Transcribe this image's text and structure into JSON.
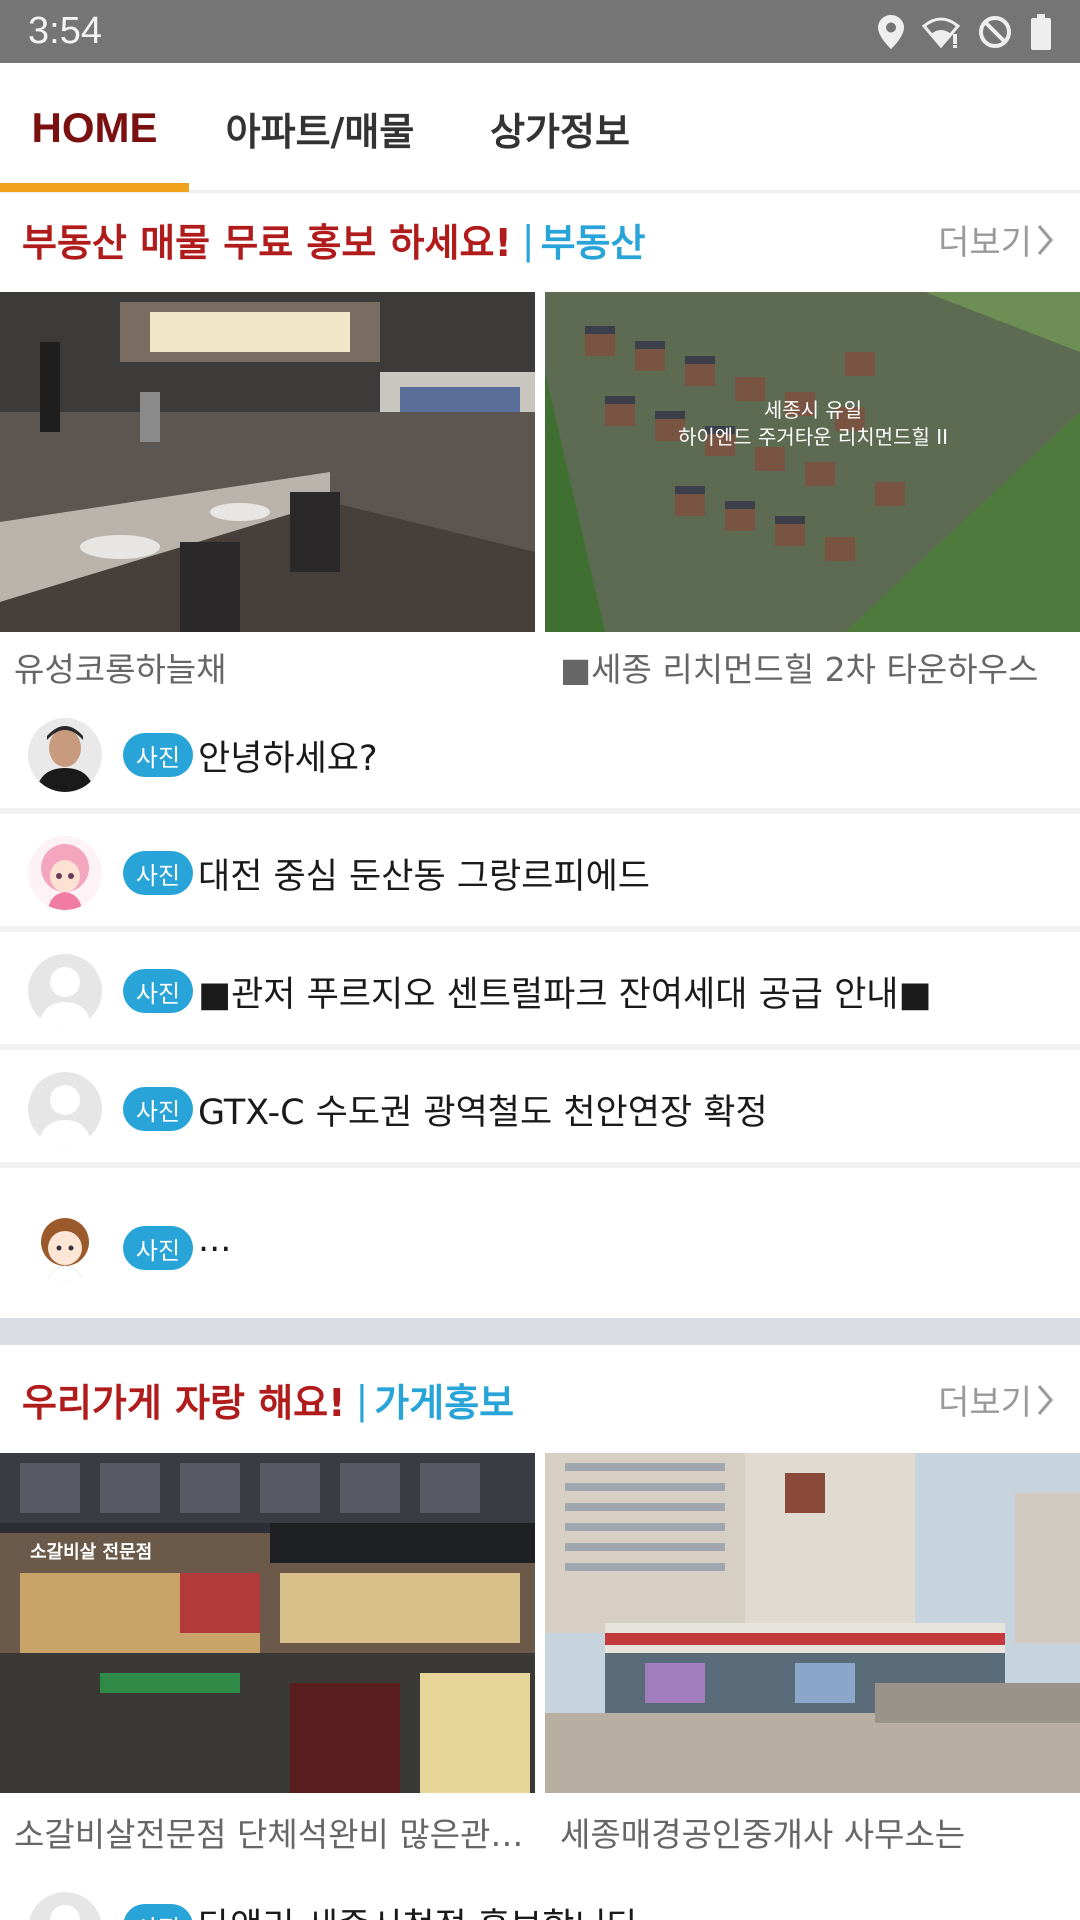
{
  "status_bar": {
    "time": "3:54"
  },
  "tabs": [
    {
      "label": "HOME"
    },
    {
      "label": "아파트/매물"
    },
    {
      "label": "상가정보"
    }
  ],
  "section1": {
    "title": "부동산 매물 무료 홍보 하세요!",
    "separator": "|",
    "subtitle": "부동산",
    "more": "더보기",
    "photos": [
      {
        "caption": "유성코롱하늘채"
      },
      {
        "caption": "■세종 리치먼드힐 2차 타운하우스",
        "overlay_line1": "세종시 유일",
        "overlay_line2": "하이엔드 주거타운 리치먼드힐 II"
      }
    ],
    "posts": [
      {
        "badge": "사진",
        "title": "안녕하세요?"
      },
      {
        "badge": "사진",
        "title": "대전 중심 둔산동 그랑르피에드"
      },
      {
        "badge": "사진",
        "title": "■관저 푸르지오 센트럴파크 잔여세대 공급 안내■"
      },
      {
        "badge": "사진",
        "title": "GTX-C 수도권 광역철도 천안연장 확정"
      },
      {
        "badge": "사진",
        "title": "..."
      }
    ]
  },
  "section2": {
    "title": "우리가게 자랑 해요!",
    "separator": "|",
    "subtitle": "가게홍보",
    "more": "더보기",
    "photos": [
      {
        "caption": "소갈비살전문점 단체석완비 많은관심부탁드립니다",
        "sign": "소갈비살 전문점"
      },
      {
        "caption": "세종매경공인중개사 사무소는"
      }
    ],
    "posts": [
      {
        "badge": "사진",
        "title": "타앤리 세종시청점 홍보합니다"
      }
    ]
  }
}
